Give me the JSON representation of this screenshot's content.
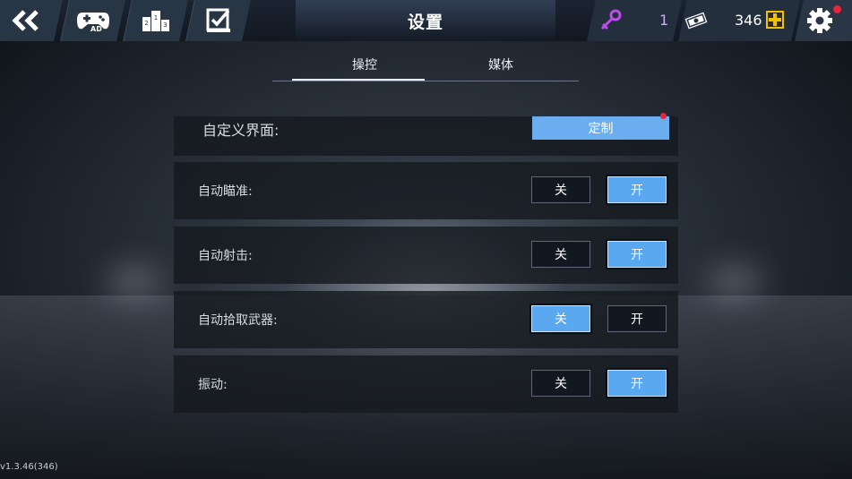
{
  "header": {
    "title": "设置",
    "back_icon": "double-chevron-left-icon",
    "nav_icons": [
      "gamepad-ad-icon",
      "leaderboard-icon",
      "task-checklist-icon"
    ],
    "ad_badge": "AD",
    "podium_numbers": [
      "2",
      "1",
      "3"
    ],
    "key_count": "1",
    "cash_count": "346",
    "add_icon": "plus-icon",
    "settings_icon": "gear-icon",
    "accent_key": "#c04cf0",
    "accent_add": "#f2c200"
  },
  "tabs": [
    {
      "label": "操控",
      "active": true
    },
    {
      "label": "媒体",
      "active": false
    }
  ],
  "custom_ui": {
    "label": "自定义界面:",
    "button": "定制"
  },
  "settings": [
    {
      "label": "自动瞄准:",
      "off": "关",
      "on": "开",
      "value": "on"
    },
    {
      "label": "自动射击:",
      "off": "关",
      "on": "开",
      "value": "on"
    },
    {
      "label": "自动拾取武器:",
      "off": "关",
      "on": "开",
      "value": "off"
    },
    {
      "label": "振动:",
      "off": "关",
      "on": "开",
      "value": "on"
    }
  ],
  "version": "v1.3.46(346)",
  "colors": {
    "toggle_active": "#5aa8f0",
    "custom_button": "#6aaef0",
    "notification": "#e8243a"
  }
}
